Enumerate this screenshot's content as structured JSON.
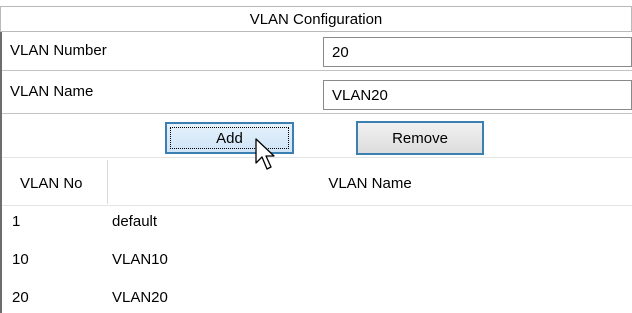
{
  "panel": {
    "title": "VLAN Configuration"
  },
  "form": {
    "vlan_number_label": "VLAN Number",
    "vlan_number_value": "20",
    "vlan_name_label": "VLAN Name",
    "vlan_name_value": "VLAN20"
  },
  "buttons": {
    "add": "Add",
    "remove": "Remove"
  },
  "table": {
    "columns": [
      "VLAN No",
      "VLAN Name"
    ],
    "rows": [
      [
        "1",
        "default"
      ],
      [
        "10",
        "VLAN10"
      ],
      [
        "20",
        "VLAN20"
      ]
    ]
  }
}
